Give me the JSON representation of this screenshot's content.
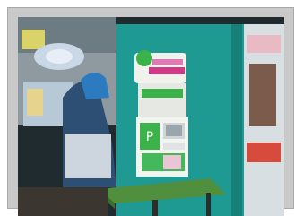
{
  "photo": {
    "subject": "",
    "colors": {
      "wall_teal": "#1f9a93",
      "kiosk_green": "#3bb24a",
      "table_green": "#4f8f3d",
      "frame_gray": "#c9c9c9"
    }
  }
}
